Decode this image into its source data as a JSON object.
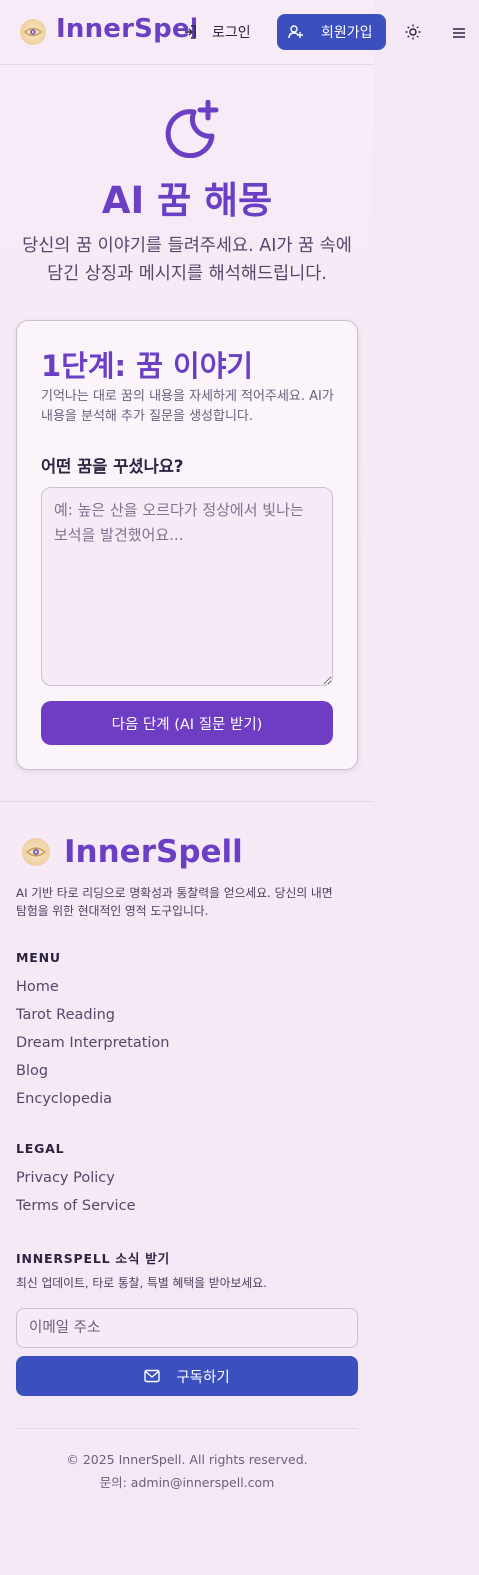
{
  "header": {
    "brand": "InnerSpell",
    "login_label": "로그인",
    "signup_label": "회원가입",
    "icons": {
      "logo": "eye-logo-icon",
      "login": "login-arrow-icon",
      "signup": "user-plus-icon",
      "theme": "sun-icon",
      "menu": "hamburger-menu-icon"
    }
  },
  "hero": {
    "icon": "moon-star-icon",
    "title": "AI 꿈 해몽",
    "description": "당신의 꿈 이야기를 들려주세요. AI가 꿈 속에 담긴 상징과 메시지를 해석해드립니다."
  },
  "step_card": {
    "title": "1단계: 꿈 이야기",
    "description": "기억나는 대로 꿈의 내용을 자세하게 적어주세요. AI가 내용을 분석해 추가 질문을 생성합니다.",
    "field_label": "어떤 꿈을 꾸셨나요?",
    "textarea_value": "",
    "textarea_placeholder": "예: 높은 산을 오르다가 정상에서 빛나는 보석을 발견했어요...",
    "next_button": "다음 단계 (AI 질문 받기)"
  },
  "footer": {
    "brand": "InnerSpell",
    "description": "AI 기반 타로 리딩으로 명확성과 통찰력을 얻으세요. 당신의 내면 탐험을 위한 현대적인 영적 도구입니다.",
    "menu_heading": "MENU",
    "menu_items": [
      "Home",
      "Tarot Reading",
      "Dream Interpretation",
      "Blog",
      "Encyclopedia"
    ],
    "legal_heading": "LEGAL",
    "legal_items": [
      "Privacy Policy",
      "Terms of Service"
    ],
    "newsletter_heading": "INNERSPELL 소식 받기",
    "newsletter_desc": "최신 업데이트, 타로 통찰, 특별 혜택을 받아보세요.",
    "email_value": "",
    "email_placeholder": "이메일 주소",
    "subscribe_label": "구독하기",
    "copyright": "© 2025 InnerSpell. All rights reserved.",
    "contact": "문의: admin@innerspell.com"
  },
  "colors": {
    "brand_purple": "#6b3fc4",
    "button_blue": "#3b4fbe",
    "button_purple": "#6e3dc4",
    "background": "#f5e8f6"
  }
}
